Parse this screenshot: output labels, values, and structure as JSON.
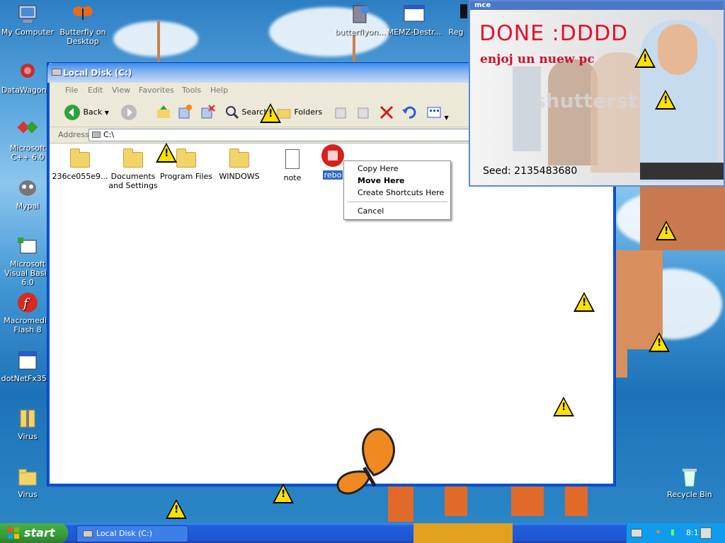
{
  "desktop": {
    "icons": [
      {
        "label": "My Computer",
        "icon": "my-computer-icon"
      },
      {
        "label": "Butterfly on Desktop",
        "icon": "butterfly-icon"
      },
      {
        "label": "butterflyon...",
        "icon": "installer-icon"
      },
      {
        "label": "MEMZ-Destr...",
        "icon": "window-icon"
      },
      {
        "label": "Reg",
        "icon": "registry-icon"
      },
      {
        "label": "DataWagon...",
        "icon": "datawagon-icon"
      },
      {
        "label": "Microsoft C++ 6.0",
        "icon": "cpp-icon"
      },
      {
        "label": "Mypal",
        "icon": "mypal-icon"
      },
      {
        "label": "Microsoft Visual Basic 6.0",
        "icon": "vb-icon"
      },
      {
        "label": "Macromedia Flash 8",
        "icon": "flash-icon"
      },
      {
        "label": "dotNetFx35...",
        "icon": "dotnet-icon"
      },
      {
        "label": "Virus",
        "icon": "zip-icon"
      },
      {
        "label": "Virus",
        "icon": "folder-icon"
      },
      {
        "label": "Recycle Bin",
        "icon": "recycle-bin-icon"
      }
    ]
  },
  "window": {
    "title": "Local Disk (C:)",
    "menu": [
      "File",
      "Edit",
      "View",
      "Favorites",
      "Tools",
      "Help"
    ],
    "toolbar": {
      "back": "Back",
      "search": "Search",
      "folders": "Folders"
    },
    "address_label": "Address",
    "address_value": "C:\\",
    "files": [
      {
        "label": "236ce055e9...",
        "type": "folder"
      },
      {
        "label": "Documents and Settings",
        "type": "folder"
      },
      {
        "label": "Program Files",
        "type": "folder"
      },
      {
        "label": "WINDOWS",
        "type": "folder"
      },
      {
        "label": "note",
        "type": "text"
      },
      {
        "label": "rebo",
        "type": "file"
      }
    ]
  },
  "context_menu": {
    "items": [
      "Copy Here",
      "Move Here",
      "Create Shortcuts Here",
      "Cancel"
    ],
    "default_item": "Move Here"
  },
  "popup": {
    "title": "mce",
    "headline": "DONE :DDDD",
    "subline": "enjoj un nuew pc",
    "watermark": "shutterst",
    "seed": "Seed: 2135483680"
  },
  "taskbar": {
    "start_label": "start",
    "task_label": "Local Disk (C:)",
    "clock": "8:1"
  },
  "colors": {
    "xp_blue": "#245edb",
    "start_green": "#3a9a3a",
    "popup_red": "#e8102a",
    "warning_yellow": "#ffe000"
  }
}
